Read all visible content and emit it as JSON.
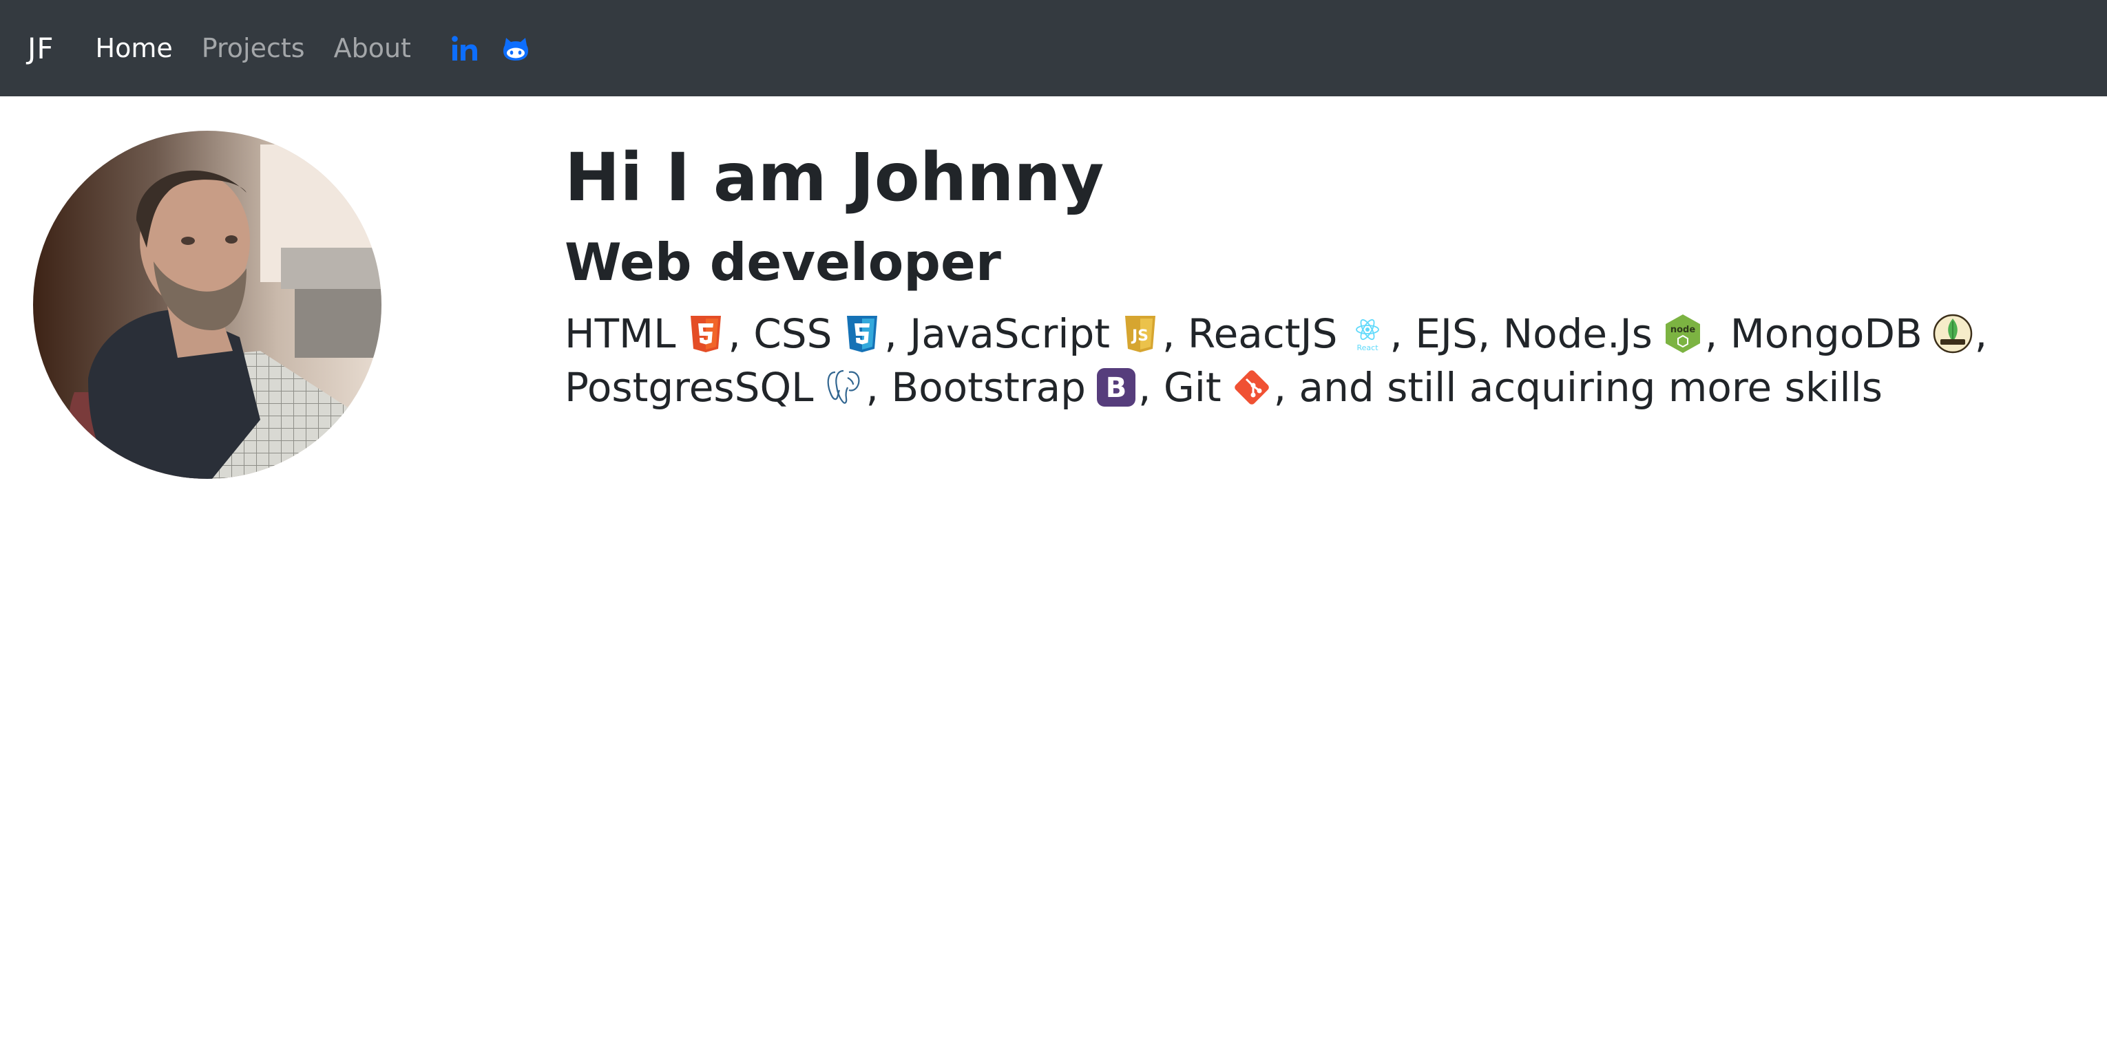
{
  "navbar": {
    "brand": "JF",
    "links": [
      {
        "label": "Home",
        "active": true
      },
      {
        "label": "Projects",
        "active": false
      },
      {
        "label": "About",
        "active": false
      }
    ],
    "social": [
      {
        "icon": "linkedin-icon",
        "label": "in"
      },
      {
        "icon": "github-icon"
      }
    ],
    "colors": {
      "background": "#343a40",
      "social": "#0d6efd"
    }
  },
  "profile": {
    "avatar_icon": "profile-photo",
    "heading": "Hi I am Johnny",
    "subheading": "Web developer"
  },
  "skills": {
    "items": [
      {
        "name": "HTML",
        "icon": "html5-icon"
      },
      {
        "name": "CSS",
        "icon": "css3-icon"
      },
      {
        "name": "JavaScript",
        "icon": "javascript-icon"
      },
      {
        "name": "ReactJS",
        "icon": "react-icon",
        "icon_text": "React"
      },
      {
        "name": "EJS"
      },
      {
        "name": "Node.Js",
        "icon": "nodejs-icon",
        "icon_text": "node"
      },
      {
        "name": "MongoDB",
        "icon": "mongodb-icon"
      },
      {
        "name": "PostgresSQL",
        "icon": "postgresql-icon"
      },
      {
        "name": "Bootstrap",
        "icon": "bootstrap-icon",
        "icon_text": "B"
      },
      {
        "name": "Git",
        "icon": "git-icon"
      }
    ],
    "separator": ",",
    "ending": ", and still acquiring more skills"
  }
}
